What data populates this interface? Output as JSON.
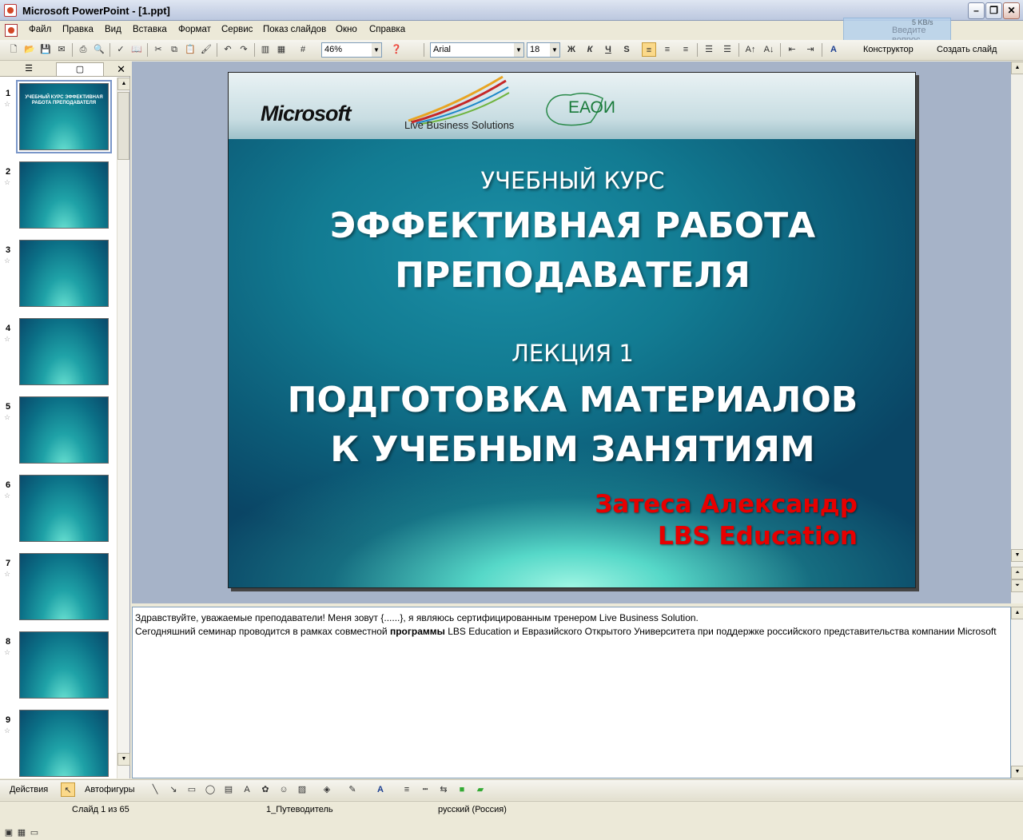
{
  "window": {
    "title": "Microsoft PowerPoint - [1.ppt]"
  },
  "menu": [
    "Файл",
    "Правка",
    "Вид",
    "Вставка",
    "Формат",
    "Сервис",
    "Показ слайдов",
    "Окно",
    "Справка"
  ],
  "help": {
    "speed": "5 KB/s",
    "placeholder": "Введите вопрос"
  },
  "toolbar": {
    "zoom": "46%",
    "font": "Arial",
    "size": "18",
    "bold": "Ж",
    "italic": "К",
    "underline": "Ч",
    "shadow": "S",
    "designer_label": "Конструктор",
    "new_slide_label": "Создать слайд"
  },
  "slides_count": 9,
  "thumbnails": [
    {
      "num": "1",
      "text": "УЧЕБНЫЙ КУРС ЭФФЕКТИВНАЯ РАБОТА ПРЕПОДАВАТЕЛЯ"
    },
    {
      "num": "2",
      "text": ""
    },
    {
      "num": "3",
      "text": ""
    },
    {
      "num": "4",
      "text": ""
    },
    {
      "num": "5",
      "text": ""
    },
    {
      "num": "6",
      "text": ""
    },
    {
      "num": "7",
      "text": ""
    },
    {
      "num": "8",
      "text": ""
    },
    {
      "num": "9",
      "text": ""
    }
  ],
  "slide": {
    "brand_ms": "Microsoft",
    "brand_lbs": "Live Business Solutions",
    "brand_eaoi": "ЕАОИ",
    "line1": "УЧЕБНЫЙ КУРС",
    "line2": "ЭФФЕКТИВНАЯ РАБОТА",
    "line3": "ПРЕПОДАВАТЕЛЯ",
    "line4": "ЛЕКЦИЯ 1",
    "line5": "ПОДГОТОВКА МАТЕРИАЛОВ",
    "line6": "К УЧЕБНЫМ ЗАНЯТИЯМ",
    "author": "Затеса Александр",
    "org": "LBS Education"
  },
  "notes": {
    "p1": "Здравствуйте, уважаемые преподаватели! Меня зовут {......}, я являюсь сертифицированным тренером Live Business Solution.",
    "p2a": "Сегодняшний семинар проводится в рамках совместной ",
    "p2b": "программы",
    "p2c": " LBS Education и Евразийского Открытого Университета при поддержке российского представительства компании Microsoft"
  },
  "drawbar": {
    "actions": "Действия",
    "autoshapes": "Автофигуры"
  },
  "status": {
    "slide": "Слайд 1 из 65",
    "design": "1_Путеводитель",
    "lang": "русский (Россия)"
  }
}
